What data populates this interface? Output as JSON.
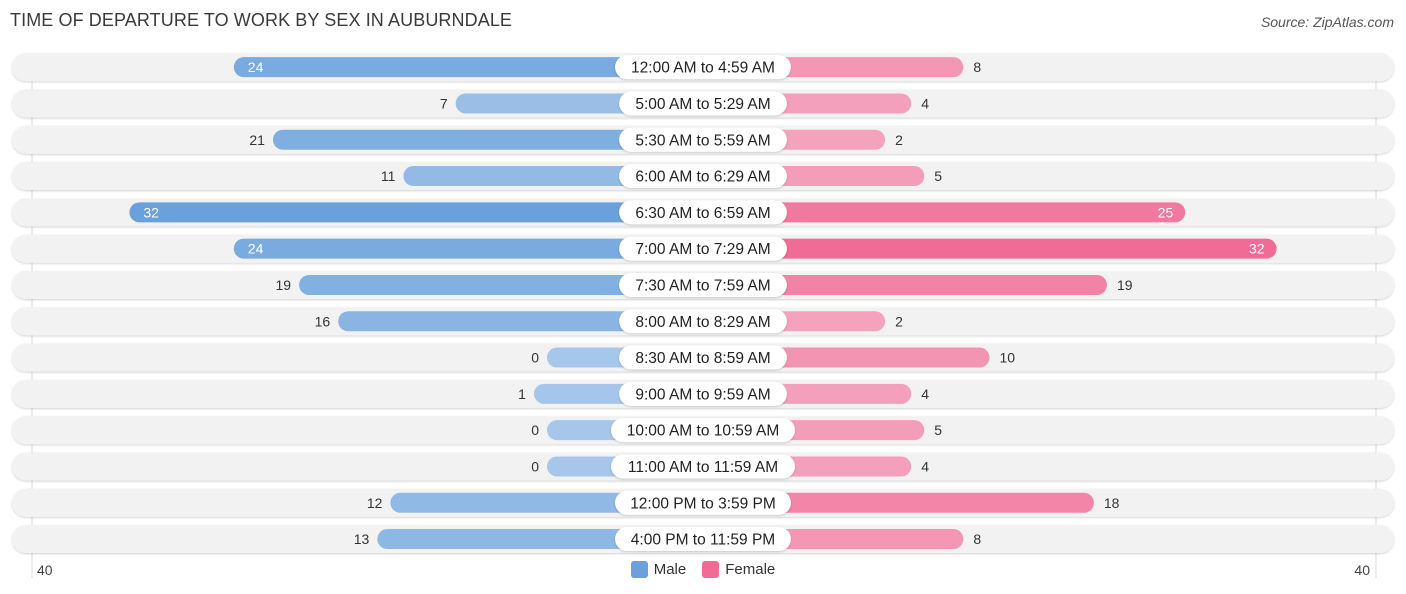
{
  "title": "TIME OF DEPARTURE TO WORK BY SEX IN AUBURNDALE",
  "source": "Source: ZipAtlas.com",
  "colors": {
    "male": "#6aa1dc",
    "male_light": "#a7c7ea",
    "female": "#f06b95",
    "female_light": "#f5a6c0",
    "track": "#f2f2f2",
    "label_bg": "#ffffff"
  },
  "legend": [
    {
      "name": "Male",
      "color": "#6aa1dc"
    },
    {
      "name": "Female",
      "color": "#f06b95"
    }
  ],
  "axis": {
    "left_label": "40",
    "right_label": "40"
  },
  "chart_data": {
    "type": "bar",
    "orientation": "horizontal-diverging",
    "title": "TIME OF DEPARTURE TO WORK BY SEX IN AUBURNDALE",
    "xlabel": "",
    "ylabel": "",
    "xlim": [
      0,
      40
    ],
    "legend_position": "bottom-center",
    "grid": false,
    "categories": [
      "12:00 AM to 4:59 AM",
      "5:00 AM to 5:29 AM",
      "5:30 AM to 5:59 AM",
      "6:00 AM to 6:29 AM",
      "6:30 AM to 6:59 AM",
      "7:00 AM to 7:29 AM",
      "7:30 AM to 7:59 AM",
      "8:00 AM to 8:29 AM",
      "8:30 AM to 8:59 AM",
      "9:00 AM to 9:59 AM",
      "10:00 AM to 10:59 AM",
      "11:00 AM to 11:59 AM",
      "12:00 PM to 3:59 PM",
      "4:00 PM to 11:59 PM"
    ],
    "series": [
      {
        "name": "Male",
        "values": [
          24,
          7,
          21,
          11,
          32,
          24,
          19,
          16,
          0,
          1,
          0,
          0,
          12,
          13
        ]
      },
      {
        "name": "Female",
        "values": [
          8,
          4,
          2,
          5,
          25,
          32,
          19,
          2,
          10,
          4,
          5,
          4,
          18,
          8
        ]
      }
    ]
  }
}
